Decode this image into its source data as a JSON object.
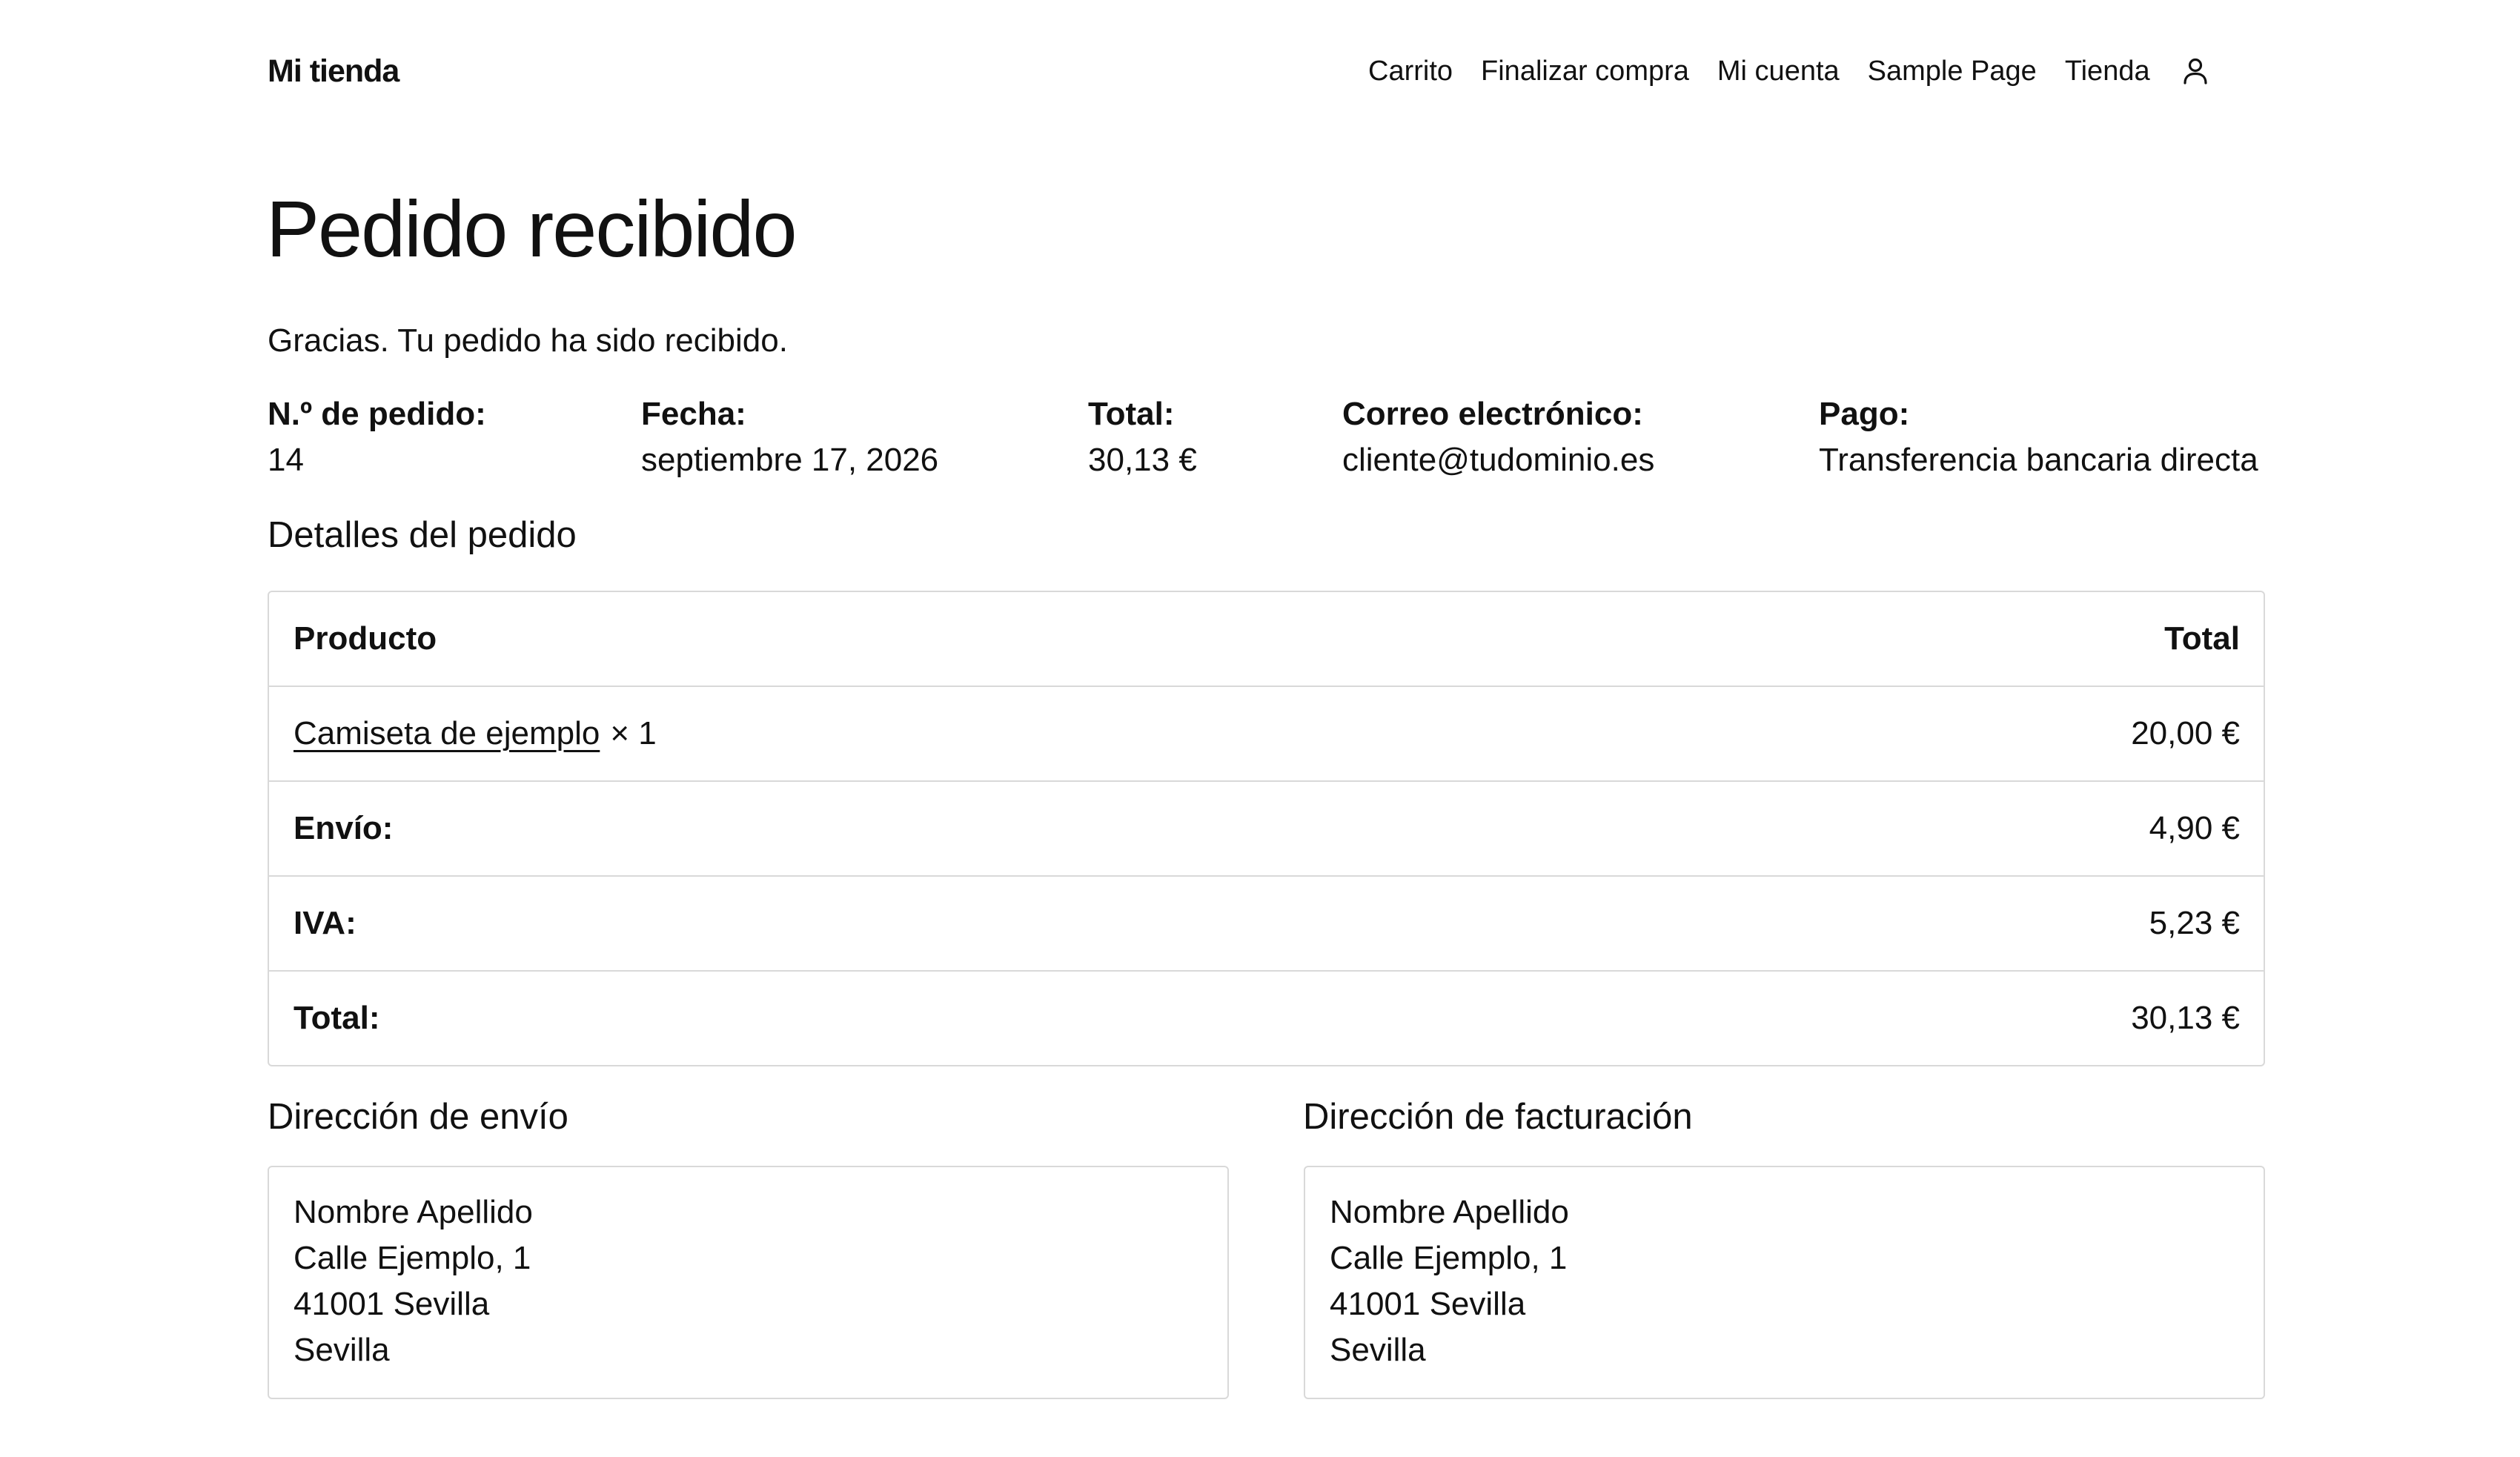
{
  "header": {
    "site_title": "Mi tienda",
    "nav": [
      {
        "label": "Carrito"
      },
      {
        "label": "Finalizar compra"
      },
      {
        "label": "Mi cuenta"
      },
      {
        "label": "Sample Page"
      },
      {
        "label": "Tienda"
      }
    ],
    "account_icon": "user-account-icon"
  },
  "page": {
    "title": "Pedido recibido",
    "thanks": "Gracias. Tu pedido ha sido recibido."
  },
  "overview": {
    "order_number": {
      "label": "N.º de pedido:",
      "value": "14"
    },
    "date": {
      "label": "Fecha:",
      "value": "septiembre 17, 2026"
    },
    "total": {
      "label": "Total:",
      "value": "30,13 €"
    },
    "email": {
      "label": "Correo electrónico:",
      "value": "cliente@tudominio.es"
    },
    "payment": {
      "label": "Pago:",
      "value": "Transferencia bancaria directa"
    }
  },
  "order_details": {
    "title": "Detalles del pedido",
    "header": {
      "product": "Producto",
      "total": "Total"
    },
    "items": [
      {
        "name": "Camiseta de ejemplo",
        "qty": "× 1",
        "total": "20,00 €"
      }
    ],
    "summary": [
      {
        "label": "Envío:",
        "value": "4,90 €"
      },
      {
        "label": "IVA:",
        "value": "5,23 €"
      },
      {
        "label": "Total:",
        "value": "30,13 €"
      }
    ]
  },
  "shipping": {
    "title": "Dirección de envío",
    "lines": [
      "Nombre Apellido",
      "Calle Ejemplo, 1",
      "41001 Sevilla",
      "Sevilla"
    ]
  },
  "billing": {
    "title": "Dirección de facturación",
    "lines": [
      "Nombre Apellido",
      "Calle Ejemplo, 1",
      "41001 Sevilla",
      "Sevilla"
    ]
  }
}
